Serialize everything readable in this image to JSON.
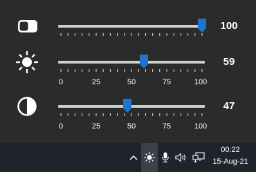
{
  "flyout": {
    "rows": [
      {
        "name": "screen-brightness",
        "icon": "screen-toggle-icon",
        "value": 100,
        "value_label": "100",
        "show_scale": false
      },
      {
        "name": "brightness",
        "icon": "sun-icon",
        "value": 59,
        "value_label": "59",
        "show_scale": true
      },
      {
        "name": "contrast",
        "icon": "contrast-icon",
        "value": 47,
        "value_label": "47",
        "show_scale": true
      }
    ],
    "scale_labels": [
      "0",
      "25",
      "50",
      "75",
      "100"
    ],
    "accent_color": "#1976d2"
  },
  "taskbar": {
    "tray_icons": [
      "chevron-up-icon",
      "sun-icon",
      "microphone-icon",
      "speaker-icon",
      "network-icon"
    ],
    "time": "00:22",
    "date": "15-Aug-21"
  }
}
